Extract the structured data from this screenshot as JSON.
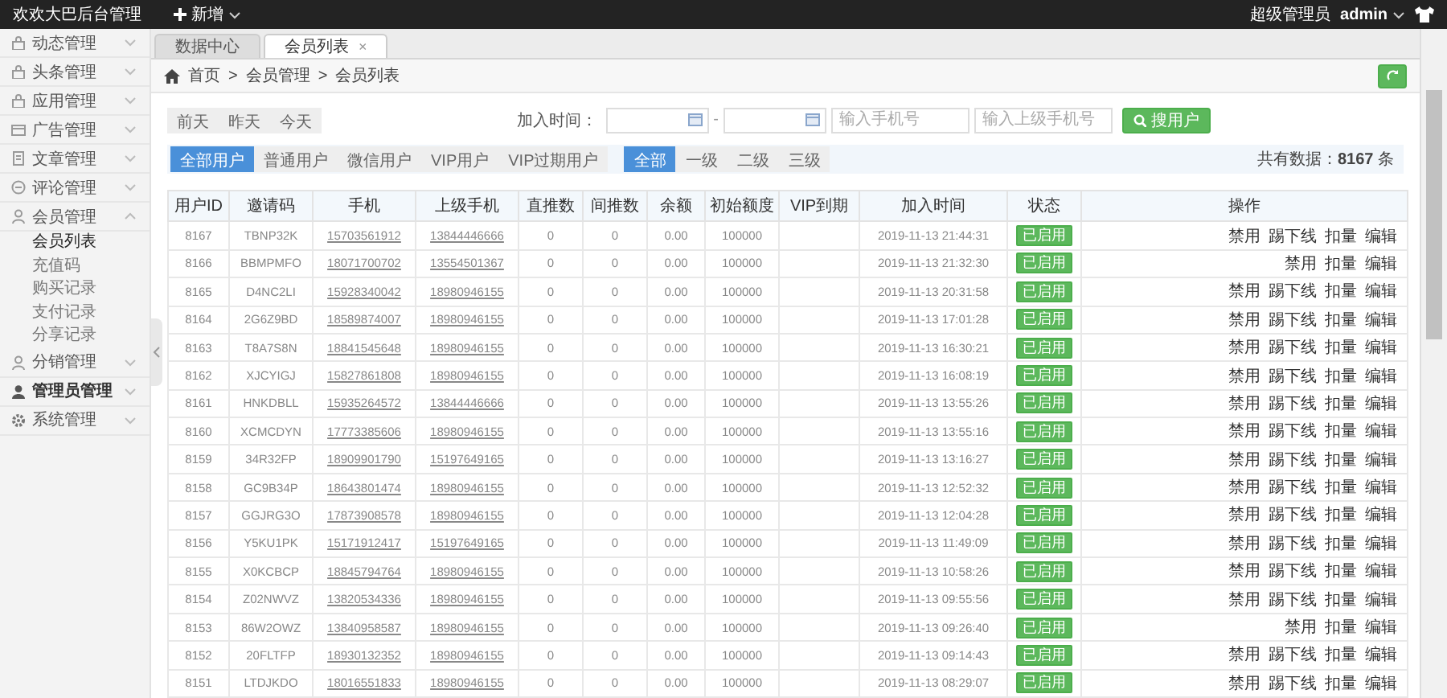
{
  "top_bar": {
    "title": "欢欢大巴后台管理",
    "new_menu": "新增",
    "role": "超级管理员",
    "user": "admin"
  },
  "sidebar": {
    "items": [
      {
        "label": "动态管理",
        "expanded": false
      },
      {
        "label": "头条管理",
        "expanded": false
      },
      {
        "label": "应用管理",
        "expanded": false
      },
      {
        "label": "广告管理",
        "expanded": false
      },
      {
        "label": "文章管理",
        "expanded": false
      },
      {
        "label": "评论管理",
        "expanded": false
      },
      {
        "label": "会员管理",
        "expanded": true,
        "children": [
          {
            "label": "会员列表",
            "selected": true
          },
          {
            "label": "充值码",
            "selected": false
          },
          {
            "label": "购买记录",
            "selected": false
          },
          {
            "label": "支付记录",
            "selected": false
          },
          {
            "label": "分享记录",
            "selected": false
          }
        ]
      },
      {
        "label": "分销管理",
        "expanded": false
      },
      {
        "label": "管理员管理",
        "expanded": false
      },
      {
        "label": "系统管理",
        "expanded": false
      }
    ]
  },
  "tabs": [
    {
      "label": "数据中心",
      "selected": false,
      "closable": false
    },
    {
      "label": "会员列表",
      "selected": true,
      "closable": true,
      "close": "×"
    }
  ],
  "breadcrumb": {
    "separator": ">",
    "items": [
      "首页",
      "会员管理",
      "会员列表"
    ]
  },
  "date_shortcuts": [
    "前天",
    "昨天",
    "今天"
  ],
  "date_range": {
    "label": "加入时间：",
    "separator": "-"
  },
  "search": {
    "phone_placeholder": "输入手机号",
    "parent_phone_placeholder": "输入上级手机号",
    "button": "搜用户"
  },
  "user_types": [
    {
      "label": "全部用户",
      "selected": true
    },
    {
      "label": "普通用户",
      "selected": false
    },
    {
      "label": "微信用户",
      "selected": false
    },
    {
      "label": "VIP用户",
      "selected": false
    },
    {
      "label": "VIP过期用户",
      "selected": false
    }
  ],
  "levels": [
    {
      "label": "全部",
      "selected": true
    },
    {
      "label": "一级",
      "selected": false
    },
    {
      "label": "二级",
      "selected": false
    },
    {
      "label": "三级",
      "selected": false
    }
  ],
  "total": "共有数据：**8167** 条",
  "table": {
    "columns": [
      {
        "label": "用户ID",
        "kind": "text"
      },
      {
        "label": "邀请码",
        "kind": "text"
      },
      {
        "label": "手机",
        "kind": "link"
      },
      {
        "label": "上级手机",
        "kind": "link"
      },
      {
        "label": "直推数",
        "kind": "text"
      },
      {
        "label": "间推数",
        "kind": "text"
      },
      {
        "label": "余额",
        "kind": "text"
      },
      {
        "label": "初始额度",
        "kind": "text"
      },
      {
        "label": "VIP到期",
        "kind": "empty"
      },
      {
        "label": "加入时间",
        "kind": "time"
      },
      {
        "label": "状态",
        "kind": "badge"
      },
      {
        "label": "操作",
        "kind": "actions"
      }
    ],
    "rows": [
      {
        "cells": [
          "8167",
          "TBNP32K",
          "15703561912",
          "13844446666",
          "0",
          "0",
          "0.00",
          "100000"
        ],
        "joined": "2019-11-13 21:44:31",
        "status": "已启用",
        "actions": [
          "禁用",
          "踢下线",
          "扣量",
          "编辑"
        ]
      },
      {
        "cells": [
          "8166",
          "BBMPMFO",
          "18071700702",
          "13554501367",
          "0",
          "0",
          "0.00",
          "100000"
        ],
        "joined": "2019-11-13 21:32:30",
        "status": "已启用",
        "actions": [
          "禁用",
          "扣量",
          "编辑"
        ]
      },
      {
        "cells": [
          "8165",
          "D4NC2LI",
          "15928340042",
          "18980946155",
          "0",
          "0",
          "0.00",
          "100000"
        ],
        "joined": "2019-11-13 20:31:58",
        "status": "已启用",
        "actions": [
          "禁用",
          "踢下线",
          "扣量",
          "编辑"
        ]
      },
      {
        "cells": [
          "8164",
          "2G6Z9BD",
          "18589874007",
          "18980946155",
          "0",
          "0",
          "0.00",
          "100000"
        ],
        "joined": "2019-11-13 17:01:28",
        "status": "已启用",
        "actions": [
          "禁用",
          "踢下线",
          "扣量",
          "编辑"
        ]
      },
      {
        "cells": [
          "8163",
          "T8A7S8N",
          "18841545648",
          "18980946155",
          "0",
          "0",
          "0.00",
          "100000"
        ],
        "joined": "2019-11-13 16:30:21",
        "status": "已启用",
        "actions": [
          "禁用",
          "踢下线",
          "扣量",
          "编辑"
        ]
      },
      {
        "cells": [
          "8162",
          "XJCYIGJ",
          "15827861808",
          "18980946155",
          "0",
          "0",
          "0.00",
          "100000"
        ],
        "joined": "2019-11-13 16:08:19",
        "status": "已启用",
        "actions": [
          "禁用",
          "踢下线",
          "扣量",
          "编辑"
        ]
      },
      {
        "cells": [
          "8161",
          "HNKDBLL",
          "15935264572",
          "13844446666",
          "0",
          "0",
          "0.00",
          "100000"
        ],
        "joined": "2019-11-13 13:55:26",
        "status": "已启用",
        "actions": [
          "禁用",
          "踢下线",
          "扣量",
          "编辑"
        ]
      },
      {
        "cells": [
          "8160",
          "XCMCDYN",
          "17773385606",
          "18980946155",
          "0",
          "0",
          "0.00",
          "100000"
        ],
        "joined": "2019-11-13 13:55:16",
        "status": "已启用",
        "actions": [
          "禁用",
          "踢下线",
          "扣量",
          "编辑"
        ]
      },
      {
        "cells": [
          "8159",
          "34R32FP",
          "18909901790",
          "15197649165",
          "0",
          "0",
          "0.00",
          "100000"
        ],
        "joined": "2019-11-13 13:16:27",
        "status": "已启用",
        "actions": [
          "禁用",
          "踢下线",
          "扣量",
          "编辑"
        ]
      },
      {
        "cells": [
          "8158",
          "GC9B34P",
          "18643801474",
          "18980946155",
          "0",
          "0",
          "0.00",
          "100000"
        ],
        "joined": "2019-11-13 12:52:32",
        "status": "已启用",
        "actions": [
          "禁用",
          "踢下线",
          "扣量",
          "编辑"
        ]
      },
      {
        "cells": [
          "8157",
          "GGJRG3O",
          "17873908578",
          "18980946155",
          "0",
          "0",
          "0.00",
          "100000"
        ],
        "joined": "2019-11-13 12:04:28",
        "status": "已启用",
        "actions": [
          "禁用",
          "踢下线",
          "扣量",
          "编辑"
        ]
      },
      {
        "cells": [
          "8156",
          "Y5KU1PK",
          "15171912417",
          "15197649165",
          "0",
          "0",
          "0.00",
          "100000"
        ],
        "joined": "2019-11-13 11:49:09",
        "status": "已启用",
        "actions": [
          "禁用",
          "踢下线",
          "扣量",
          "编辑"
        ]
      },
      {
        "cells": [
          "8155",
          "X0KCBCP",
          "18845794764",
          "18980946155",
          "0",
          "0",
          "0.00",
          "100000"
        ],
        "joined": "2019-11-13 10:58:26",
        "status": "已启用",
        "actions": [
          "禁用",
          "踢下线",
          "扣量",
          "编辑"
        ]
      },
      {
        "cells": [
          "8154",
          "Z02NWVZ",
          "13820534336",
          "18980946155",
          "0",
          "0",
          "0.00",
          "100000"
        ],
        "joined": "2019-11-13 09:55:56",
        "status": "已启用",
        "actions": [
          "禁用",
          "踢下线",
          "扣量",
          "编辑"
        ]
      },
      {
        "cells": [
          "8153",
          "86W2OWZ",
          "13840958587",
          "18980946155",
          "0",
          "0",
          "0.00",
          "100000"
        ],
        "joined": "2019-11-13 09:26:40",
        "status": "已启用",
        "actions": [
          "禁用",
          "扣量",
          "编辑"
        ]
      },
      {
        "cells": [
          "8152",
          "20FLTFP",
          "18930132352",
          "18980946155",
          "0",
          "0",
          "0.00",
          "100000"
        ],
        "joined": "2019-11-13 09:14:43",
        "status": "已启用",
        "actions": [
          "禁用",
          "踢下线",
          "扣量",
          "编辑"
        ]
      },
      {
        "cells": [
          "8151",
          "LTDJKDO",
          "18016551833",
          "18980946155",
          "0",
          "0",
          "0.00",
          "100000"
        ],
        "joined": "2019-11-13 08:29:07",
        "status": "已启用",
        "actions": [
          "禁用",
          "踢下线",
          "扣量",
          "编辑"
        ]
      }
    ]
  }
}
